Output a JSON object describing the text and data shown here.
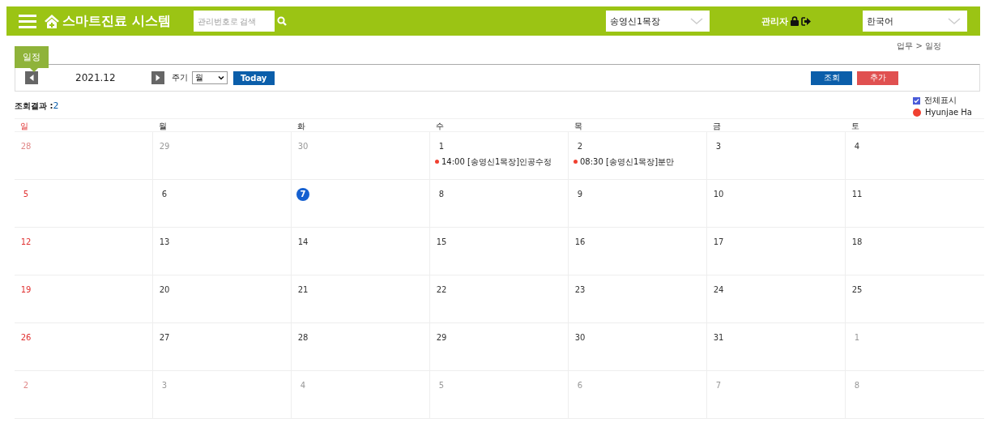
{
  "header": {
    "title": "스마트진료 시스템",
    "search": {
      "placeholder": "관리번호로 검색"
    },
    "farm_select": {
      "value": "송영신1목장"
    },
    "user": "관리자",
    "language_select": {
      "value": "한국어"
    }
  },
  "breadcrumb": "업무 > 일정",
  "tabs": [
    {
      "label": "일정",
      "selected": true
    }
  ],
  "toolbar": {
    "month": "2021.12",
    "period_label": "주기",
    "period_select": {
      "value": "월"
    },
    "today_button": "Today",
    "search_button": "조회",
    "add_button": "추가"
  },
  "result": {
    "label": "조회결과 :",
    "count": "2"
  },
  "legend": [
    {
      "kind": "checkbox",
      "label": "전체표시",
      "checked": true
    },
    {
      "kind": "dot",
      "label": "Hyunjae Ha",
      "color": "#f04030"
    }
  ],
  "calendar": {
    "weekdays": [
      "일",
      "월",
      "화",
      "수",
      "목",
      "금",
      "토"
    ],
    "weeks": [
      [
        {
          "day": "28",
          "muted": true
        },
        {
          "day": "29",
          "muted": true
        },
        {
          "day": "30",
          "muted": true
        },
        {
          "day": "1",
          "muted": false,
          "events": [
            {
              "text": "14:00 [송영신1목장]인공수정",
              "color": "#f04030"
            }
          ]
        },
        {
          "day": "2",
          "muted": false,
          "events": [
            {
              "text": "08:30 [송영신1목장]분만",
              "color": "#f04030"
            }
          ]
        },
        {
          "day": "3",
          "muted": false
        },
        {
          "day": "4",
          "muted": false
        }
      ],
      [
        {
          "day": "5",
          "muted": false
        },
        {
          "day": "6",
          "muted": false
        },
        {
          "day": "7",
          "muted": false,
          "selected": true
        },
        {
          "day": "8",
          "muted": false
        },
        {
          "day": "9",
          "muted": false
        },
        {
          "day": "10",
          "muted": false
        },
        {
          "day": "11",
          "muted": false
        }
      ],
      [
        {
          "day": "12",
          "muted": false
        },
        {
          "day": "13",
          "muted": false
        },
        {
          "day": "14",
          "muted": false
        },
        {
          "day": "15",
          "muted": false
        },
        {
          "day": "16",
          "muted": false
        },
        {
          "day": "17",
          "muted": false
        },
        {
          "day": "18",
          "muted": false
        }
      ],
      [
        {
          "day": "19",
          "muted": false
        },
        {
          "day": "20",
          "muted": false
        },
        {
          "day": "21",
          "muted": false
        },
        {
          "day": "22",
          "muted": false
        },
        {
          "day": "23",
          "muted": false
        },
        {
          "day": "24",
          "muted": false
        },
        {
          "day": "25",
          "muted": false
        }
      ],
      [
        {
          "day": "26",
          "muted": false
        },
        {
          "day": "27",
          "muted": false
        },
        {
          "day": "28",
          "muted": false
        },
        {
          "day": "29",
          "muted": false
        },
        {
          "day": "30",
          "muted": false
        },
        {
          "day": "31",
          "muted": false
        },
        {
          "day": "1",
          "muted": true
        }
      ],
      [
        {
          "day": "2",
          "muted": true
        },
        {
          "day": "3",
          "muted": true
        },
        {
          "day": "4",
          "muted": true
        },
        {
          "day": "5",
          "muted": true
        },
        {
          "day": "6",
          "muted": true
        },
        {
          "day": "7",
          "muted": true
        },
        {
          "day": "8",
          "muted": true
        }
      ]
    ]
  }
}
